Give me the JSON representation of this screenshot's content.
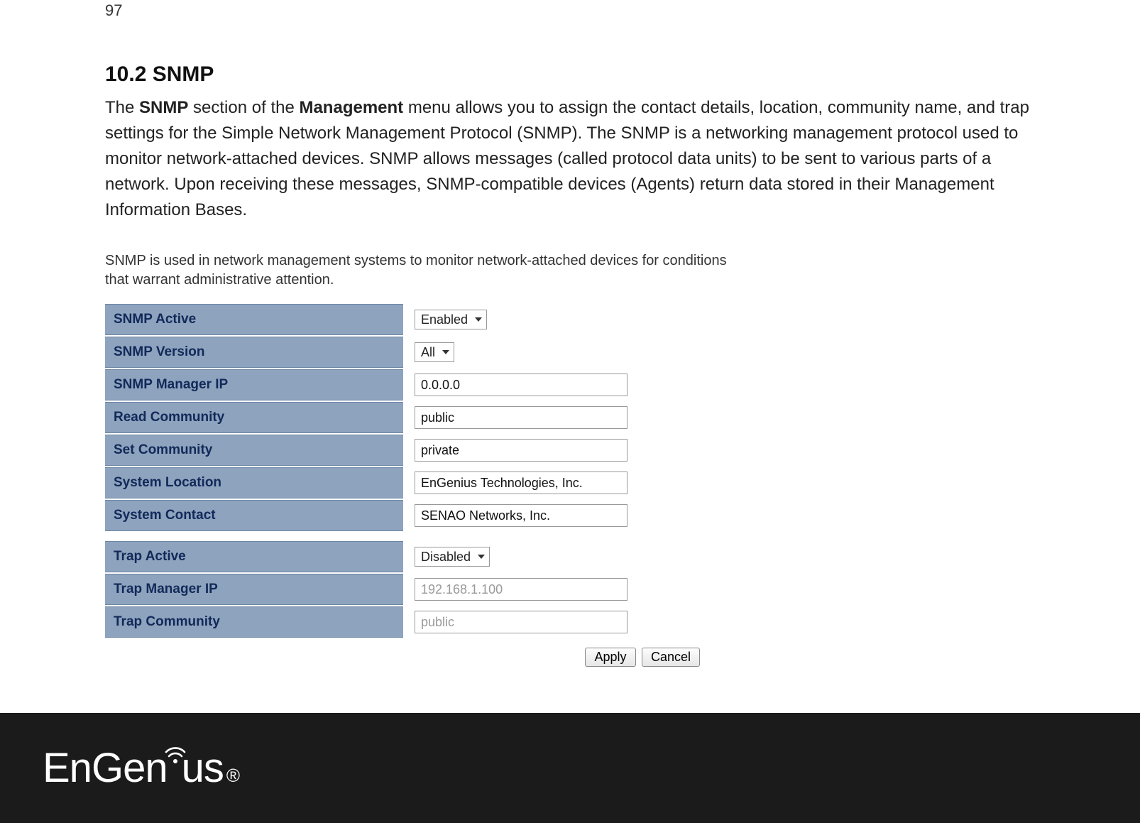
{
  "page_number": "97",
  "heading": "10.2 SNMP",
  "paragraph_pre": "The ",
  "paragraph_bold1": "SNMP",
  "paragraph_mid1": " section of the ",
  "paragraph_bold2": "Management",
  "paragraph_post": " menu allows you to assign the contact details, location, community name, and trap settings for the Simple Network Management Protocol (SNMP). The SNMP is a networking management protocol used to monitor network-attached devices. SNMP allows messages (called protocol data units) to be sent to various parts of a network. Upon receiving these messages, SNMP-compatible devices (Agents) return data stored in their Management Information Bases.",
  "snmp_note": "SNMP is used in network management systems to monitor network-attached devices for conditions that warrant administrative attention.",
  "rows": {
    "snmp_active": {
      "label": "SNMP Active",
      "value": "Enabled"
    },
    "snmp_version": {
      "label": "SNMP Version",
      "value": "All"
    },
    "snmp_manager_ip": {
      "label": "SNMP Manager IP",
      "value": "0.0.0.0"
    },
    "read_community": {
      "label": "Read Community",
      "value": "public"
    },
    "set_community": {
      "label": "Set Community",
      "value": "private"
    },
    "system_location": {
      "label": "System Location",
      "value": "EnGenius Technologies, Inc."
    },
    "system_contact": {
      "label": "System Contact",
      "value": "SENAO Networks, Inc."
    },
    "trap_active": {
      "label": "Trap Active",
      "value": "Disabled"
    },
    "trap_manager_ip": {
      "label": "Trap Manager IP",
      "value": "192.168.1.100"
    },
    "trap_community": {
      "label": "Trap Community",
      "value": "public"
    }
  },
  "buttons": {
    "apply": "Apply",
    "cancel": "Cancel"
  },
  "logo_text": {
    "en": "En",
    "gen": "Gen",
    "us": "us",
    "reg": "®"
  }
}
